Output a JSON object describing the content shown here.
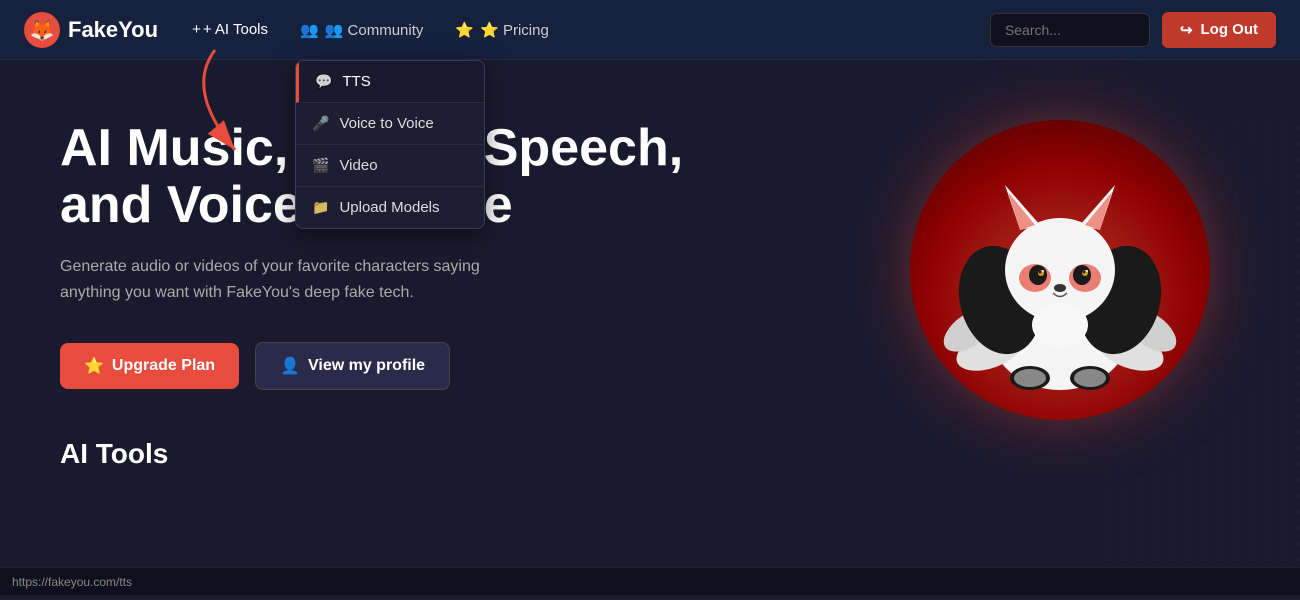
{
  "navbar": {
    "logo_text": "FakeYou",
    "nav_items": [
      {
        "id": "ai-tools",
        "label": "+ AI Tools",
        "has_arrow": true
      },
      {
        "id": "community",
        "label": "👥 Community",
        "has_arrow": true
      },
      {
        "id": "pricing",
        "label": "⭐ Pricing",
        "has_arrow": false
      }
    ],
    "search_placeholder": "Search...",
    "logout_label": "Log Out",
    "logout_icon": "→"
  },
  "dropdown": {
    "items": [
      {
        "id": "tts",
        "label": "TTS",
        "icon": "💬",
        "highlighted": true
      },
      {
        "id": "voice-to-voice",
        "label": "Voice to Voice",
        "icon": "🎤",
        "highlighted": false
      },
      {
        "id": "video",
        "label": "Video",
        "icon": "🎬",
        "highlighted": false
      },
      {
        "id": "upload-models",
        "label": "Upload Models",
        "icon": "📁",
        "highlighted": false
      }
    ]
  },
  "hero": {
    "title": "AI Music, Text to Speech,\nand Voice to voice",
    "subtitle": "Generate audio or videos of your favorite characters saying anything you want with FakeYou's deep fake tech.",
    "btn_upgrade": "Upgrade Plan",
    "btn_upgrade_icon": "⭐",
    "btn_profile": "View my profile",
    "btn_profile_icon": "👤",
    "ai_tools_heading": "AI Tools"
  },
  "status_bar": {
    "url": "https://fakeyou.com/tts"
  },
  "colors": {
    "accent_red": "#e74c3c",
    "bg_dark": "#1a1a2e",
    "bg_nav": "#16213e",
    "btn_secondary": "#2a2a4a"
  }
}
